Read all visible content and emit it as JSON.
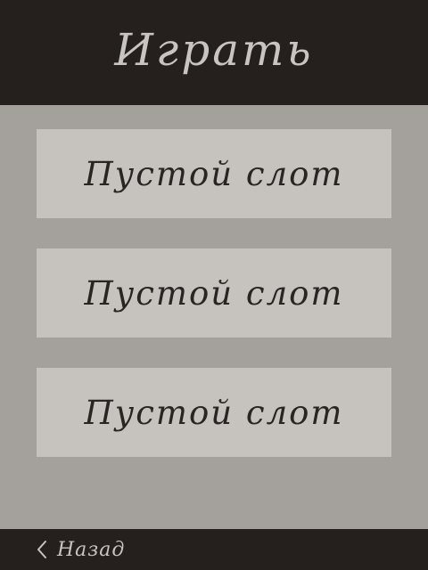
{
  "header": {
    "title": "Играть"
  },
  "slots": [
    {
      "label": "Пустой слот"
    },
    {
      "label": "Пустой слот"
    },
    {
      "label": "Пустой слот"
    }
  ],
  "footer": {
    "back_label": "Назад",
    "back_icon": "chevron-left-icon"
  },
  "colors": {
    "bar_background": "#25201e",
    "page_background": "#a4a09c",
    "slot_background": "#c6c3bf",
    "light_text": "#c8c4c0",
    "dark_text": "#2a2523"
  }
}
